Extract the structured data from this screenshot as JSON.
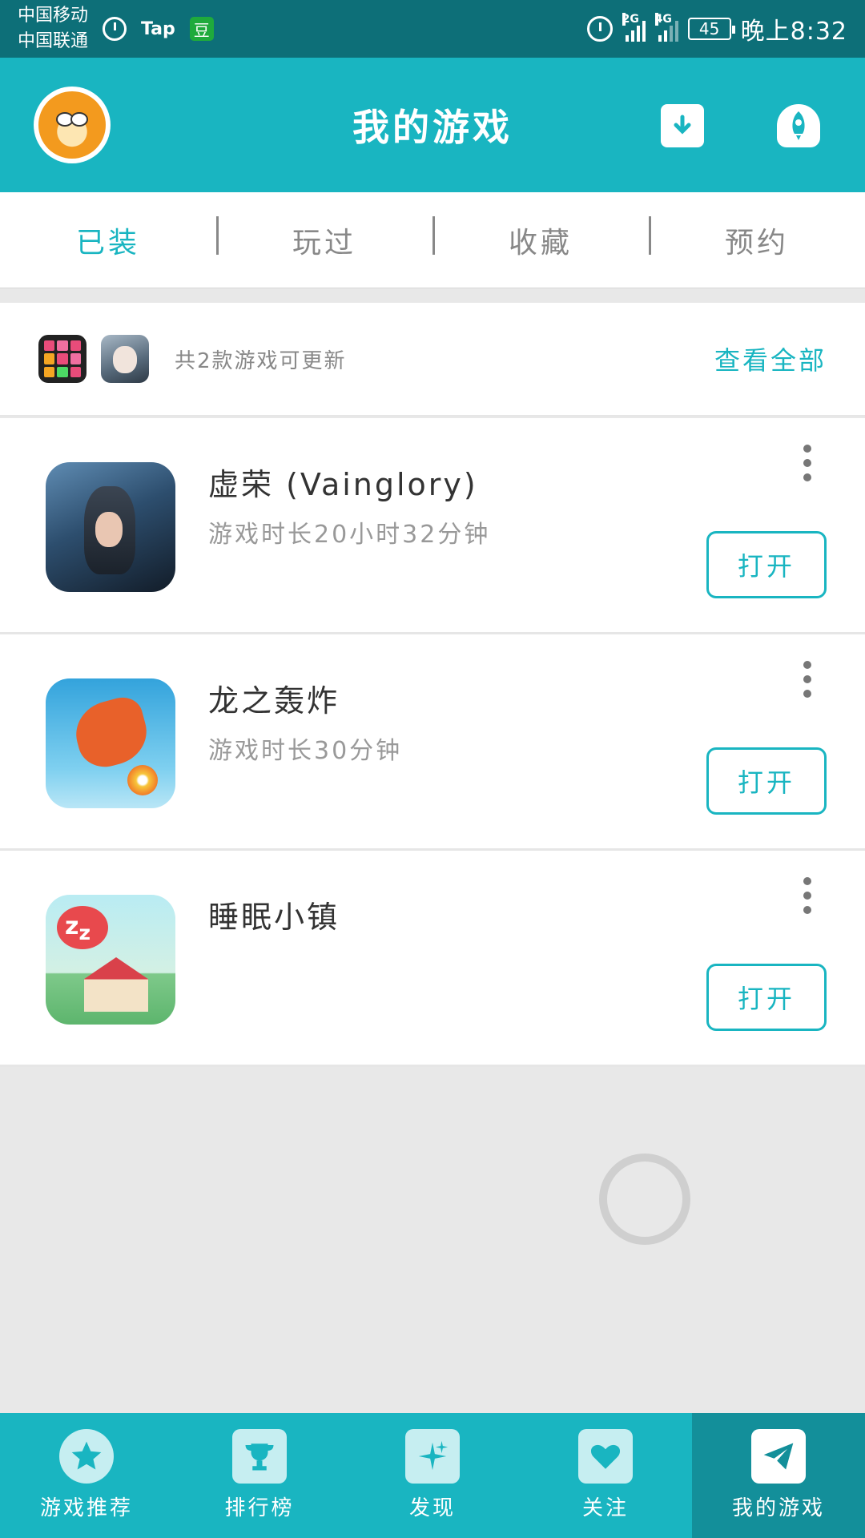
{
  "status_bar": {
    "carrier1": "中国移动",
    "carrier2": "中国联通",
    "tap": "Tap",
    "dou": "豆",
    "net1": "2G",
    "net2": "4G",
    "battery": "45",
    "time": "晚上8:32"
  },
  "header": {
    "title": "我的游戏"
  },
  "tabs": [
    {
      "label": "已装",
      "active": true
    },
    {
      "label": "玩过",
      "active": false
    },
    {
      "label": "收藏",
      "active": false
    },
    {
      "label": "预约",
      "active": false
    }
  ],
  "update_bar": {
    "text": "共2款游戏可更新",
    "view_all": "查看全部"
  },
  "games": [
    {
      "name": "虚荣 (Vainglory)",
      "playtime": "游戏时长20小时32分钟",
      "open_label": "打开"
    },
    {
      "name": "龙之轰炸",
      "playtime": "游戏时长30分钟",
      "open_label": "打开"
    },
    {
      "name": "睡眠小镇",
      "playtime": "",
      "open_label": "打开"
    }
  ],
  "bottom_nav": [
    {
      "label": "游戏推荐",
      "icon": "star-icon",
      "active": false
    },
    {
      "label": "排行榜",
      "icon": "trophy-icon",
      "active": false
    },
    {
      "label": "发现",
      "icon": "sparkle-icon",
      "active": false
    },
    {
      "label": "关注",
      "icon": "heart-icon",
      "active": false
    },
    {
      "label": "我的游戏",
      "icon": "paper-plane-icon",
      "active": true
    }
  ],
  "colors": {
    "accent": "#19b5c1",
    "status_bar": "#0d6f78",
    "nav_active": "#138f9a"
  }
}
